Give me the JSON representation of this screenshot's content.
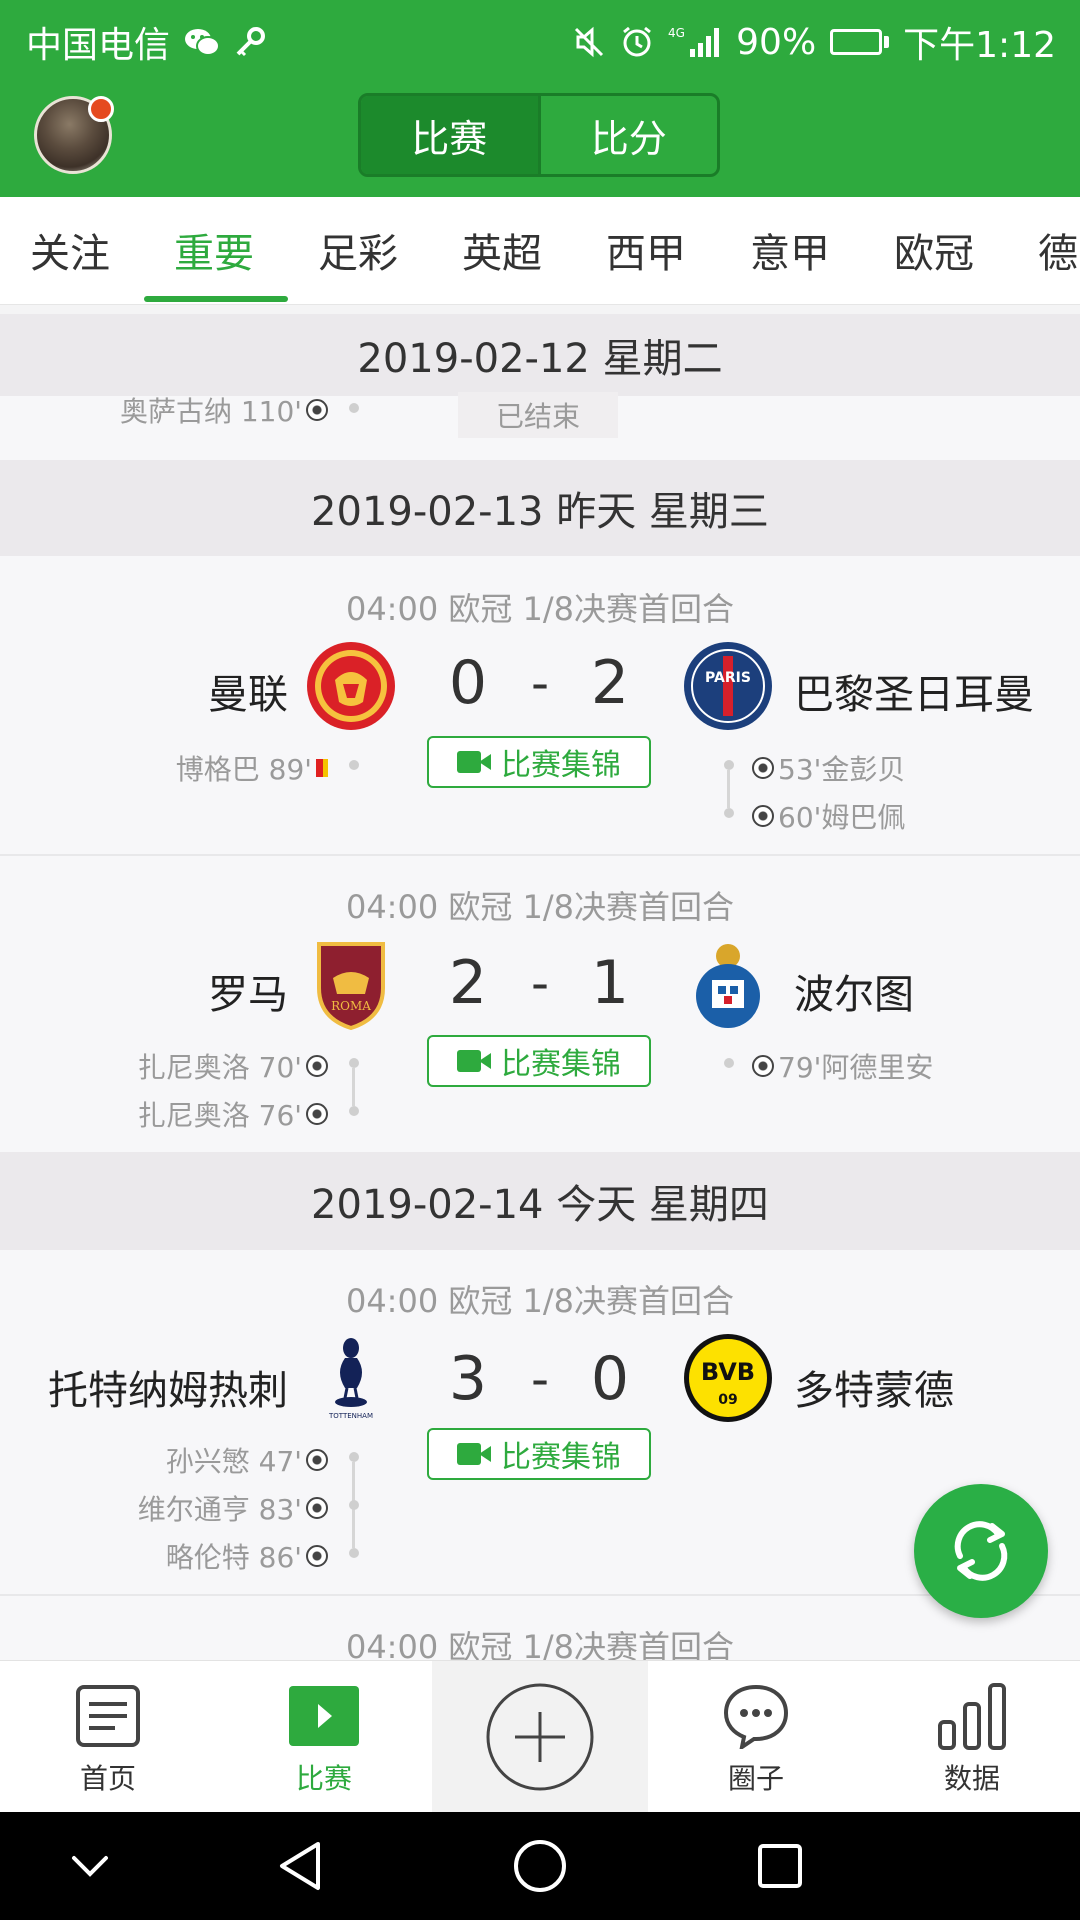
{
  "status_bar": {
    "carrier": "中国电信",
    "signal_label": "4G",
    "battery_percent": "90%",
    "battery_level": 0.9,
    "time": "下午1:12"
  },
  "header": {
    "segments": [
      {
        "label": "比赛",
        "active": true
      },
      {
        "label": "比分",
        "active": false
      }
    ]
  },
  "tabs": [
    {
      "label": "关注"
    },
    {
      "label": "重要",
      "active": true
    },
    {
      "label": "足彩"
    },
    {
      "label": "英超"
    },
    {
      "label": "西甲"
    },
    {
      "label": "意甲"
    },
    {
      "label": "欧冠"
    },
    {
      "label": "德"
    }
  ],
  "days": [
    {
      "date": "2019-02-12 星期二",
      "partial_event": "奥萨古纳 110'",
      "status": "已结束"
    },
    {
      "date": "2019-02-13 昨天 星期三",
      "matches": [
        {
          "meta": "04:00 欧冠 1/8决赛首回合",
          "home": "曼联",
          "away": "巴黎圣日耳曼",
          "home_score": "0",
          "away_score": "2",
          "dash": "-",
          "home_logo": "manchester-united-crest",
          "away_logo": "psg-crest",
          "highlights": "比赛集锦",
          "home_events": [
            "博格巴 89'"
          ],
          "away_events": [
            "53'金彭贝",
            "60'姆巴佩"
          ]
        },
        {
          "meta": "04:00 欧冠 1/8决赛首回合",
          "home": "罗马",
          "away": "波尔图",
          "home_score": "2",
          "away_score": "1",
          "dash": "-",
          "home_logo": "as-roma-crest",
          "away_logo": "fc-porto-crest",
          "highlights": "比赛集锦",
          "home_events": [
            "扎尼奥洛 70'",
            "扎尼奥洛 76'"
          ],
          "away_events": [
            "79'阿德里安"
          ]
        }
      ]
    },
    {
      "date": "2019-02-14 今天 星期四",
      "matches": [
        {
          "meta": "04:00 欧冠 1/8决赛首回合",
          "home": "托特纳姆热刺",
          "away": "多特蒙德",
          "home_score": "3",
          "away_score": "0",
          "dash": "-",
          "home_logo": "tottenham-crest",
          "away_logo": "bvb-crest",
          "highlights": "比赛集锦",
          "home_events": [
            "孙兴慜 47'",
            "维尔通亨 83'",
            "略伦特 86'"
          ],
          "away_events": []
        }
      ],
      "next_meta": "04:00 欧冠 1/8决赛首回合"
    }
  ],
  "bottom_nav": [
    {
      "label": "首页",
      "icon": "document-icon"
    },
    {
      "label": "比赛",
      "icon": "play-icon",
      "active": true
    },
    {
      "label": "",
      "icon": "plus-icon"
    },
    {
      "label": "圈子",
      "icon": "chat-icon"
    },
    {
      "label": "数据",
      "icon": "bar-chart-icon"
    }
  ],
  "colors": {
    "brand_green": "#2eaa3e",
    "header_green": "#2eaa3e",
    "fab_green": "#2aaf46"
  }
}
